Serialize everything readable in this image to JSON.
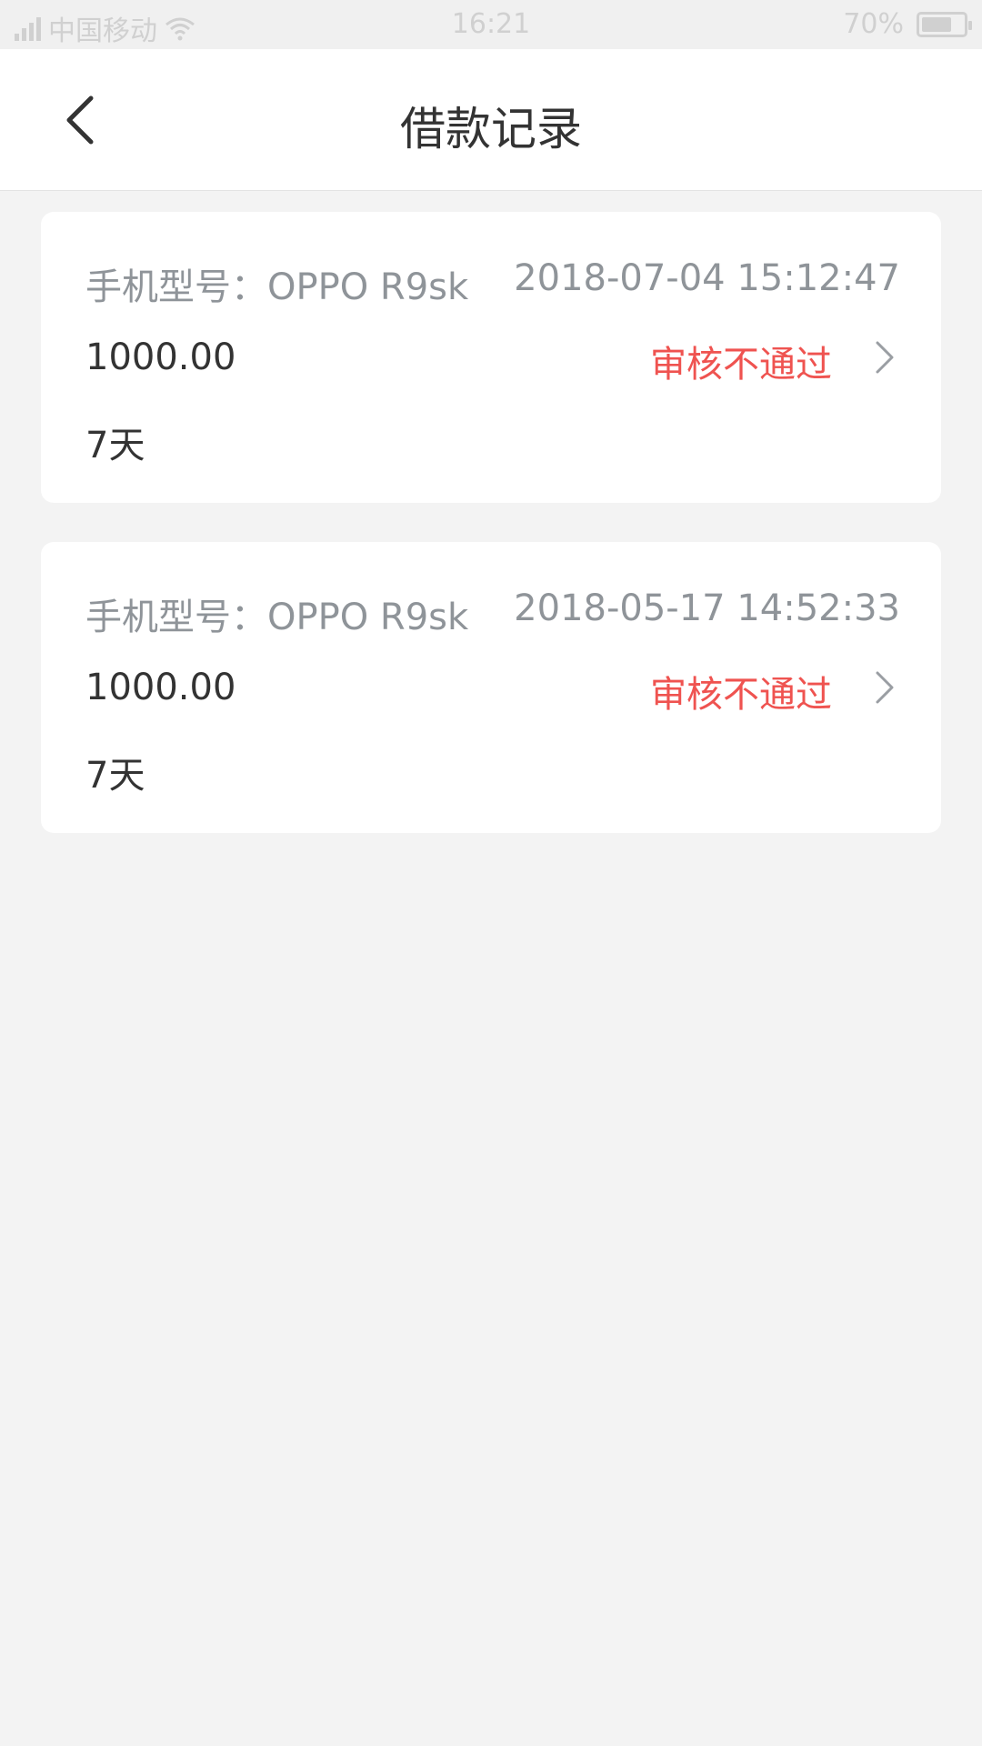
{
  "status_bar": {
    "carrier": "中国移动",
    "time": "16:21",
    "battery": "70%",
    "battery_level": 0.7
  },
  "header": {
    "title": "借款记录",
    "back_icon": "chevron-left-icon"
  },
  "records": [
    {
      "model": "手机型号：OPPO R9sk",
      "time": "2018-07-04 15:12:47",
      "amount": "1000.00",
      "status": "审核不通过",
      "duration": "7天"
    },
    {
      "model": "手机型号：OPPO R9sk",
      "time": "2018-05-17 14:52:33",
      "amount": "1000.00",
      "status": "审核不通过",
      "duration": "7天"
    }
  ],
  "colors": {
    "background": "#f3f3f3",
    "status_reject": "#ef5350",
    "text_primary": "#333333",
    "text_secondary": "#8f9499"
  }
}
